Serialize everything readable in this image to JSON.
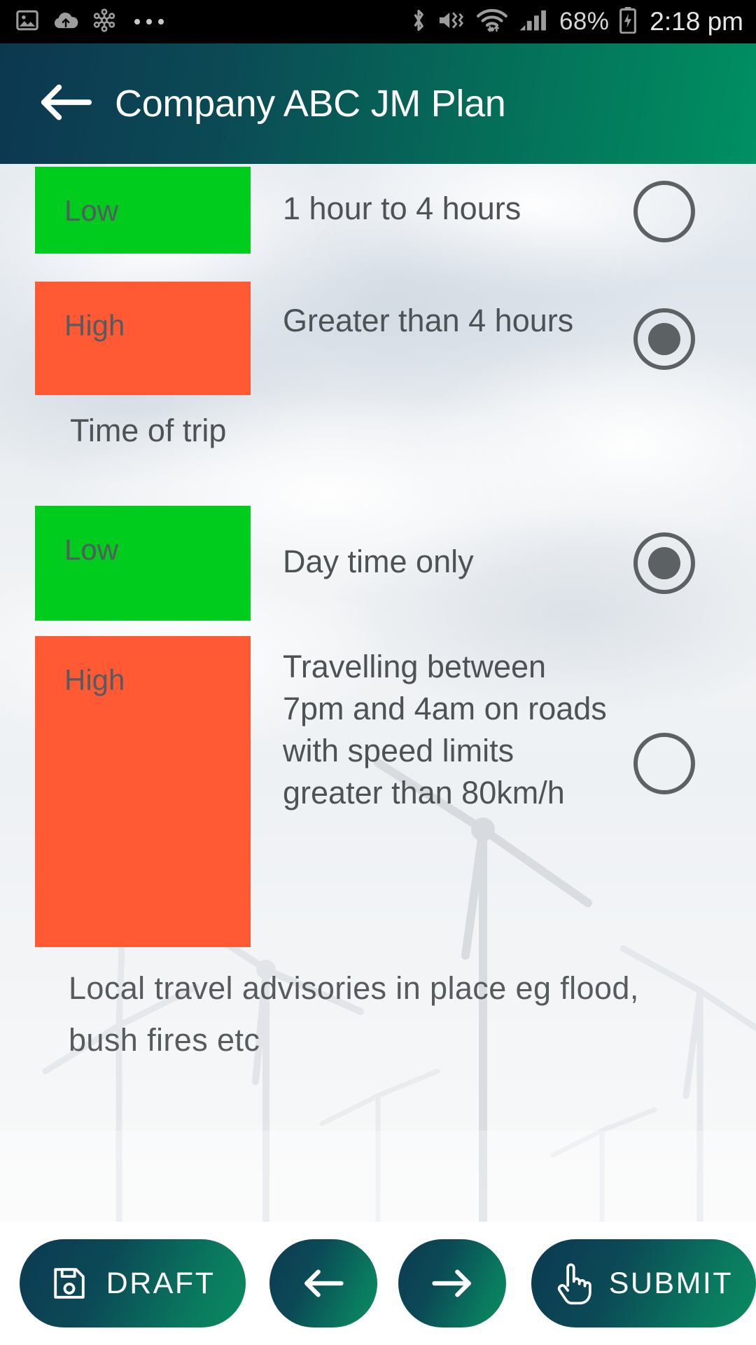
{
  "statusbar": {
    "left_icons": [
      "image-icon",
      "cloud-upload-icon",
      "hub-network-icon",
      "more-dots-icon"
    ],
    "right_icons": [
      "bluetooth-icon",
      "mute-vibrate-icon",
      "wifi-icon",
      "signal-bars-icon",
      "battery-icon"
    ],
    "battery_percent": "68%",
    "time": "2:18 pm"
  },
  "appbar": {
    "back_icon": "arrow-left-icon",
    "title": "Company ABC JM Plan",
    "gradient_from": "#0c3750",
    "gradient_to": "#009062"
  },
  "colors": {
    "severity_low": "#00cc1e",
    "severity_high": "#ff5a33",
    "text": "#4d5255",
    "radio": "#5c6164"
  },
  "groups": [
    {
      "heading": "",
      "options": [
        {
          "severity": "Low",
          "text": "1 hour to 4 hours",
          "selected": false
        },
        {
          "severity": "High",
          "text": "Greater than 4 hours",
          "selected": true
        }
      ]
    },
    {
      "heading": "Time of trip",
      "options": [
        {
          "severity": "Low",
          "text": "Day time only",
          "selected": true
        },
        {
          "severity": "High",
          "text": "Travelling between 7pm and 4am on roads with speed limits greater than 80km/h",
          "selected": false
        }
      ]
    }
  ],
  "trailing_label": "Local travel advisories in place eg flood, bush fires etc",
  "bottombar": {
    "buttons": [
      {
        "name": "draft",
        "label": "DRAFT",
        "icon": "save-floppy-icon"
      },
      {
        "name": "prev",
        "label": "",
        "icon": "arrow-left-icon"
      },
      {
        "name": "next",
        "label": "",
        "icon": "arrow-right-icon"
      },
      {
        "name": "submit",
        "label": "SUBMIT",
        "icon": "pointing-hand-icon"
      }
    ]
  }
}
